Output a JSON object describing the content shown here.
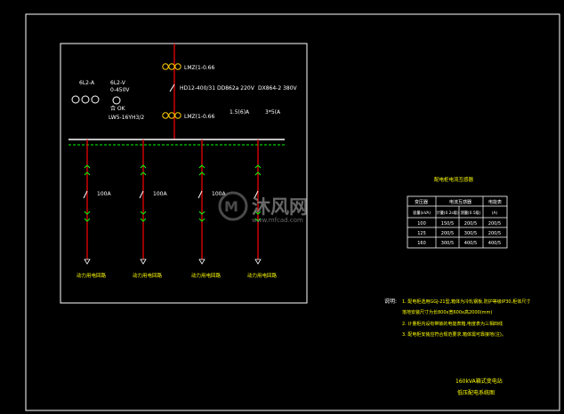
{
  "diagram": {
    "top_components": {
      "fuse_top": "LMZ(1-0.66",
      "switch": "HD12-400/31",
      "fuse_bottom": "LMZ(1-0.66",
      "meter_left_a": "6L2-A",
      "meter_left_b": "6L2-V",
      "meter_left_b2": "0-450V",
      "meter_left_c": "合 OK",
      "meter_left_d": "LW5-16YH3/2",
      "meter_mid_a": "DD862a 220V",
      "meter_mid_b": "1.5(6)A",
      "meter_right_a": "DX864-2 380V",
      "meter_right_b": "3*5(A"
    },
    "branches": [
      {
        "breaker": "100A",
        "load": "动力用电回路"
      },
      {
        "breaker": "100A",
        "load": "动力用电回路"
      },
      {
        "breaker": "100A",
        "load": "动力用电回路"
      },
      {
        "breaker": "",
        "load": "动力用电回路"
      }
    ],
    "watermark": {
      "text": "沐风网",
      "url": "www.mfcad.com"
    },
    "table": {
      "title": "配电柜电流互感器",
      "headers": [
        "变压器",
        "电流互感器",
        "",
        "电能表"
      ],
      "subheaders": [
        "容量(kVA)",
        "计量(0.2s级)",
        "测量(0.5级)",
        "(A)"
      ],
      "rows": [
        [
          "100",
          "150/5",
          "200/5",
          "200/5"
        ],
        [
          "125",
          "200/5",
          "300/5",
          "200/5"
        ],
        [
          "160",
          "300/5",
          "400/5",
          "400/5"
        ]
      ]
    },
    "notes": {
      "label": "说明:",
      "items": [
        "1. 配电柜选用GGJ-21型,箱体为冷轧钢板,防护等级IP30,柜体尺寸",
        "   落地安装尺寸为长800x宽600x高2000(mm)",
        "2. 计量柜内设有带锁的电能表箱,电度表为三相四线",
        "3. 配电柜安装应符合规范要求,箱体需可靠接地(注)。"
      ]
    },
    "title_block": {
      "line1": "160kVA箱式变电站",
      "line2": "低压配电系统图"
    }
  }
}
